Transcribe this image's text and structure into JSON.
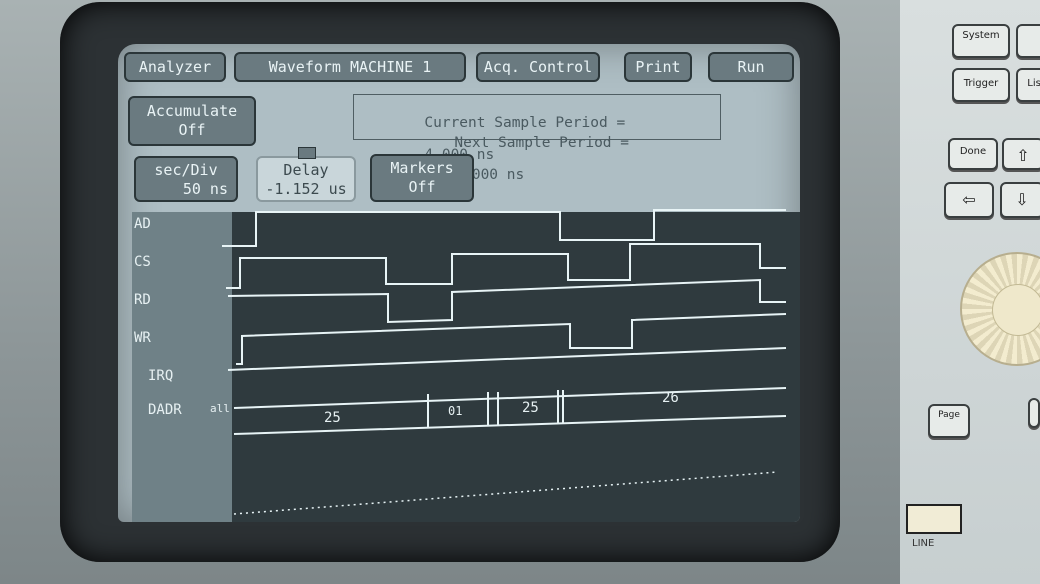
{
  "toolbar": {
    "analyzer": "Analyzer",
    "waveform": "Waveform MACHINE 1",
    "acq_control": "Acq. Control",
    "print": "Print",
    "run": "Run"
  },
  "accumulate": {
    "label": "Accumulate",
    "value": "Off"
  },
  "sample_info": {
    "current_label": "Current Sample Period =",
    "current_value": "4.000 ns",
    "next_label": "Next Sample Period =",
    "next_value": "4.000 ns"
  },
  "sec_div": {
    "label": "sec/Div",
    "value": "50 ns"
  },
  "delay": {
    "label": "Delay",
    "value": "-1.152 us"
  },
  "markers": {
    "label": "Markers",
    "value": "Off"
  },
  "signals": [
    {
      "name": "AD"
    },
    {
      "name": "CS"
    },
    {
      "name": "RD"
    },
    {
      "name": "WR"
    },
    {
      "name": "IRQ"
    },
    {
      "name": "DADR",
      "suffix": "all"
    }
  ],
  "bus_values": [
    "25",
    "01",
    "25",
    "26"
  ],
  "panel": {
    "system": "System",
    "trigger": "Trigger",
    "list": "List",
    "done": "Done",
    "page": "Page",
    "line": "LINE"
  },
  "colors": {
    "trace": "#e8f4f6",
    "screen_bg": "#2f3a3e",
    "label_bg": "#6f8187"
  }
}
